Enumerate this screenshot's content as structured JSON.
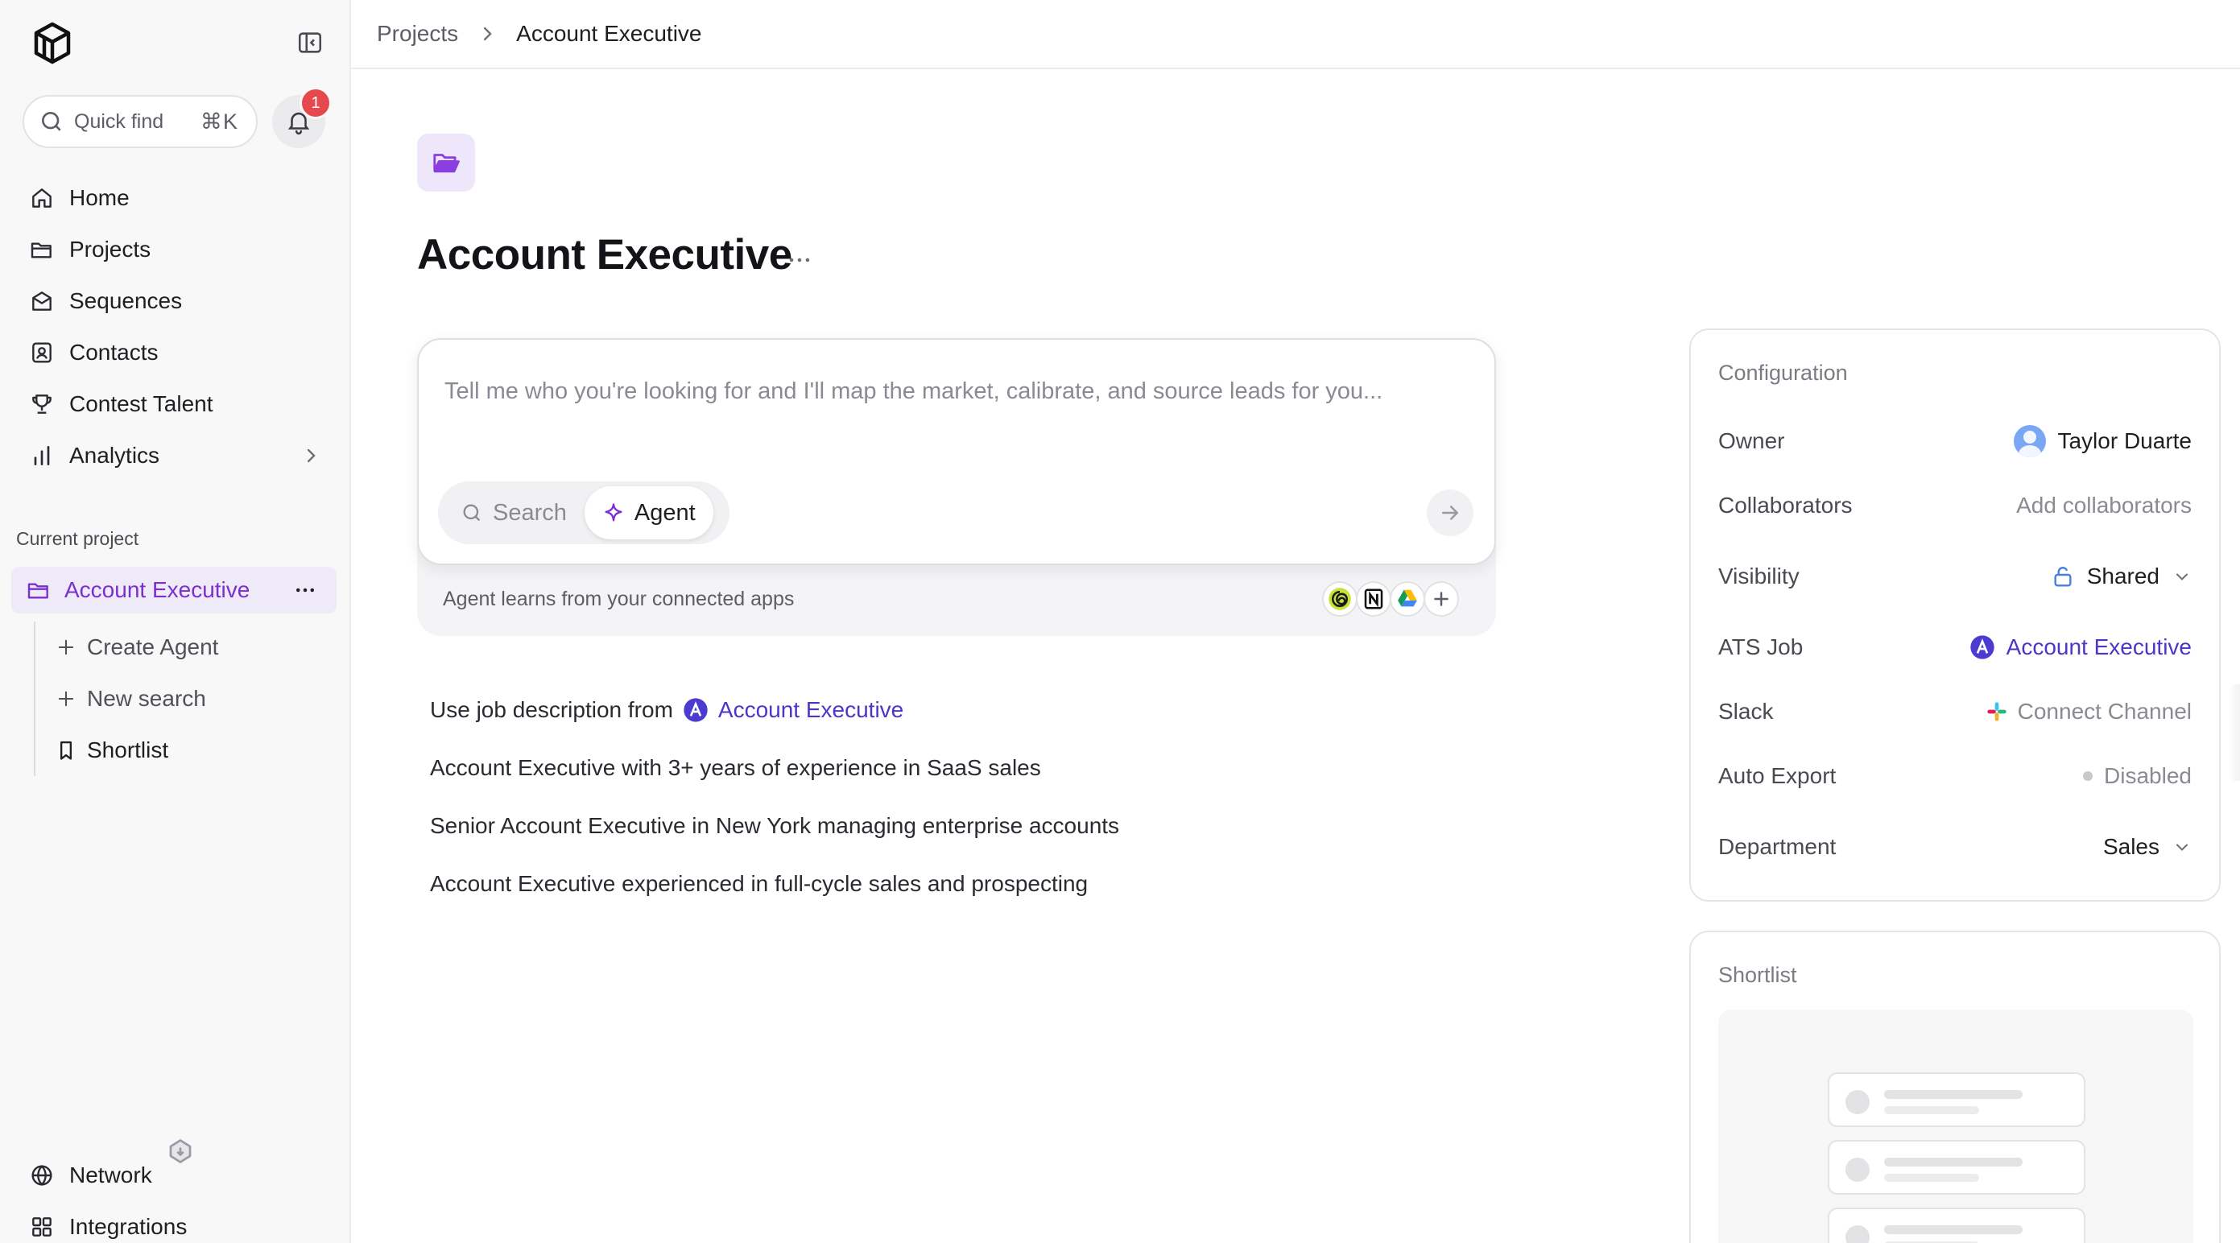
{
  "sidebar": {
    "quick_find": {
      "label": "Quick find",
      "shortcut": "⌘K"
    },
    "notifications": {
      "count": "1"
    },
    "nav": [
      {
        "label": "Home",
        "icon": "home-icon"
      },
      {
        "label": "Projects",
        "icon": "folder-icon"
      },
      {
        "label": "Sequences",
        "icon": "mail-stack-icon"
      },
      {
        "label": "Contacts",
        "icon": "contact-card-icon"
      },
      {
        "label": "Contest Talent",
        "icon": "trophy-icon"
      },
      {
        "label": "Analytics",
        "icon": "bar-chart-icon"
      }
    ],
    "current_project_label": "Current project",
    "current_project": {
      "name": "Account Executive",
      "color": "#7b2fd0"
    },
    "project_items": [
      {
        "label": "Create Agent",
        "icon": "plus-icon"
      },
      {
        "label": "New search",
        "icon": "plus-icon"
      },
      {
        "label": "Shortlist",
        "icon": "bookmark-icon"
      }
    ],
    "bottom_nav": [
      {
        "label": "Network",
        "icon": "globe-icon"
      },
      {
        "label": "Integrations",
        "icon": "grid-icon"
      }
    ]
  },
  "breadcrumb": {
    "parent": "Projects",
    "current": "Account Executive"
  },
  "page": {
    "title": "Account Executive"
  },
  "composer": {
    "placeholder": "Tell me who you're looking for and I'll map the market, calibrate, and source leads for you...",
    "modes": {
      "search": "Search",
      "agent": "Agent",
      "active": "Agent"
    },
    "apps_note": "Agent learns from your connected apps"
  },
  "suggestions": {
    "job_prefix": "Use job description from",
    "job_link": "Account Executive",
    "items": [
      "Account Executive with 3+ years of experience in SaaS sales",
      "Senior Account Executive in New York managing enterprise accounts",
      "Account Executive experienced in full-cycle sales and prospecting"
    ]
  },
  "configuration": {
    "title": "Configuration",
    "owner": {
      "label": "Owner",
      "value": "Taylor Duarte"
    },
    "collaborators": {
      "label": "Collaborators",
      "value": "Add collaborators"
    },
    "visibility": {
      "label": "Visibility",
      "value": "Shared"
    },
    "ats_job": {
      "label": "ATS Job",
      "value": "Account Executive"
    },
    "slack": {
      "label": "Slack",
      "value": "Connect Channel"
    },
    "auto_export": {
      "label": "Auto Export",
      "value": "Disabled"
    },
    "department": {
      "label": "Department",
      "value": "Sales"
    }
  },
  "shortlist_panel": {
    "title": "Shortlist"
  },
  "colors": {
    "accent": "#7b2fd0",
    "link": "#4a36c9",
    "badge": "#e5484d"
  }
}
